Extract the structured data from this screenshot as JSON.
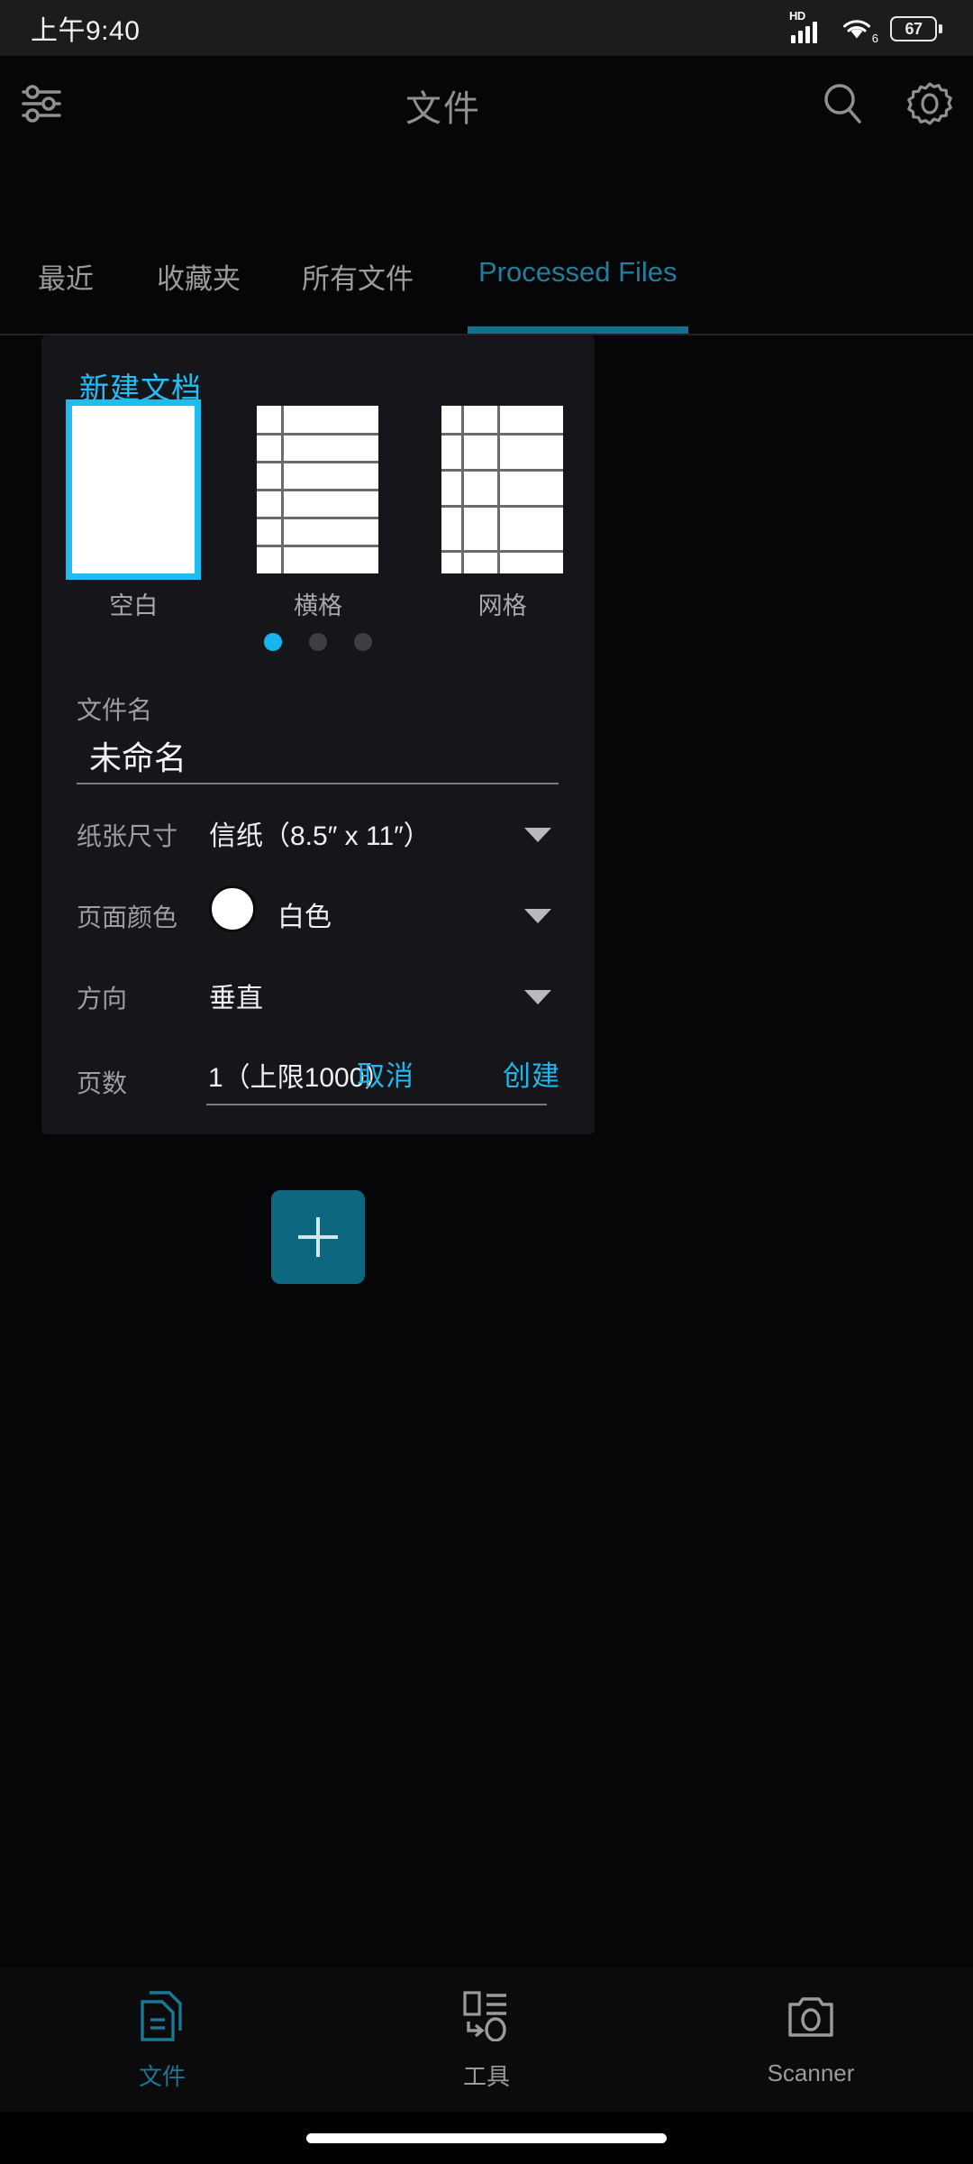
{
  "status_bar": {
    "time": "上午9:40",
    "hd_label": "HD",
    "wifi_gen": "6",
    "battery_level": "67"
  },
  "app_bar": {
    "title": "文件",
    "filter_icon": "sliders-icon",
    "search_icon": "search-icon",
    "settings_icon": "gear-icon"
  },
  "tabs": [
    {
      "label": "最近",
      "active": false
    },
    {
      "label": "收藏夹",
      "active": false
    },
    {
      "label": "所有文件",
      "active": false
    },
    {
      "label": "Processed Files",
      "active": true
    }
  ],
  "dialog": {
    "title": "新建文档",
    "templates": [
      {
        "label": "空白",
        "type": "blank",
        "selected": true
      },
      {
        "label": "横格",
        "type": "lined",
        "selected": false
      },
      {
        "label": "网格",
        "type": "grid",
        "selected": false
      }
    ],
    "page_dots": {
      "count": 3,
      "active_index": 0
    },
    "filename": {
      "label": "文件名",
      "value": "未命名"
    },
    "paper_size": {
      "label": "纸张尺寸",
      "value": "信纸（8.5″ x 11″）"
    },
    "page_color": {
      "label": "页面颜色",
      "value": "白色",
      "swatch_hex": "#ffffff"
    },
    "orientation": {
      "label": "方向",
      "value": "垂直"
    },
    "page_count": {
      "label": "页数",
      "value": "1（上限1000）"
    },
    "cancel_label": "取消",
    "create_label": "创建"
  },
  "fab": {
    "icon": "plus-icon"
  },
  "bottom_nav": [
    {
      "label": "文件",
      "icon": "document-icon",
      "active": true
    },
    {
      "label": "工具",
      "icon": "tools-icon",
      "active": false
    },
    {
      "label": "Scanner",
      "icon": "camera-icon",
      "active": false
    }
  ],
  "colors": {
    "accent_cyan": "#20bff5",
    "tab_teal": "#1f7f9c",
    "fab_teal": "#0d687f",
    "dialog_bg": "#16161a"
  }
}
